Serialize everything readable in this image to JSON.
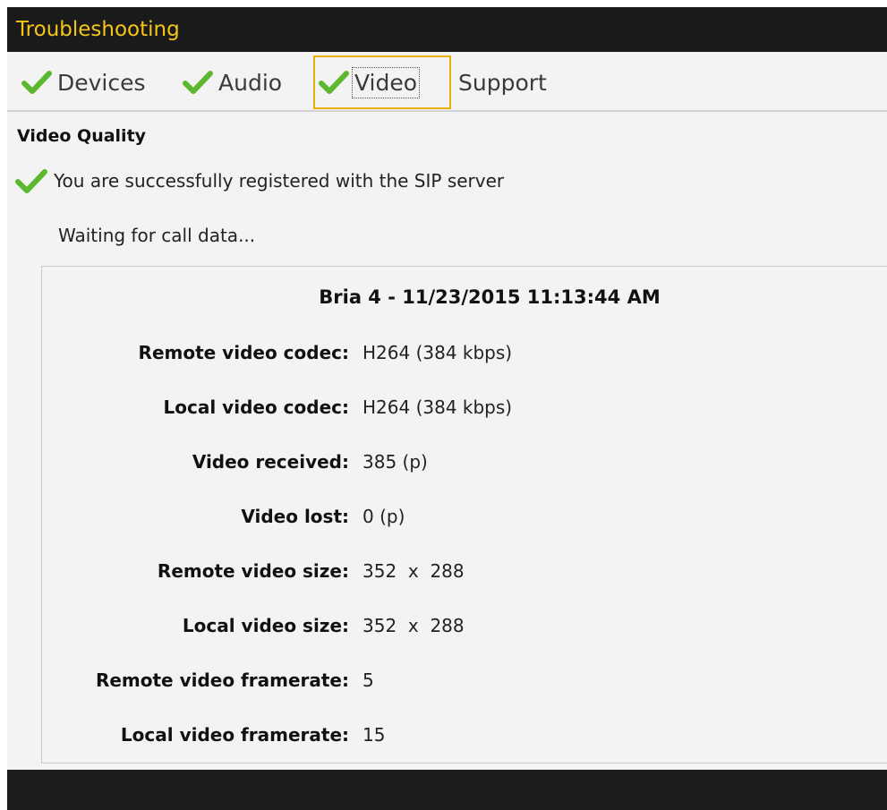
{
  "window": {
    "title": "Troubleshooting"
  },
  "tabs": [
    {
      "label": "Devices",
      "checked": true,
      "active": false
    },
    {
      "label": "Audio",
      "checked": true,
      "active": false
    },
    {
      "label": "Video",
      "checked": true,
      "active": true
    },
    {
      "label": "Support",
      "checked": false,
      "active": false
    }
  ],
  "section": {
    "title": "Video Quality",
    "status": "You are successfully registered with the SIP server",
    "waiting": "Waiting for call data..."
  },
  "panel": {
    "header": "Bria 4  - 11/23/2015 11:13:44 AM",
    "rows": [
      {
        "label": "Remote video codec:",
        "value": "H264 (384 kbps)"
      },
      {
        "label": "Local video codec:",
        "value": "H264 (384 kbps)"
      },
      {
        "label": "Video received:",
        "value": "385 (p)"
      },
      {
        "label": "Video lost:",
        "value": "0 (p)"
      },
      {
        "label": "Remote video size:",
        "value": "352  x  288"
      },
      {
        "label": "Local video size:",
        "value": "352  x  288"
      },
      {
        "label": "Remote video framerate:",
        "value": "5"
      },
      {
        "label": "Local video framerate:",
        "value": "15"
      }
    ]
  },
  "colors": {
    "titlebar_bg": "#1a1a1a",
    "title_text": "#f5c518",
    "check_green": "#5cb82e",
    "active_tab_border": "#e8b100"
  }
}
